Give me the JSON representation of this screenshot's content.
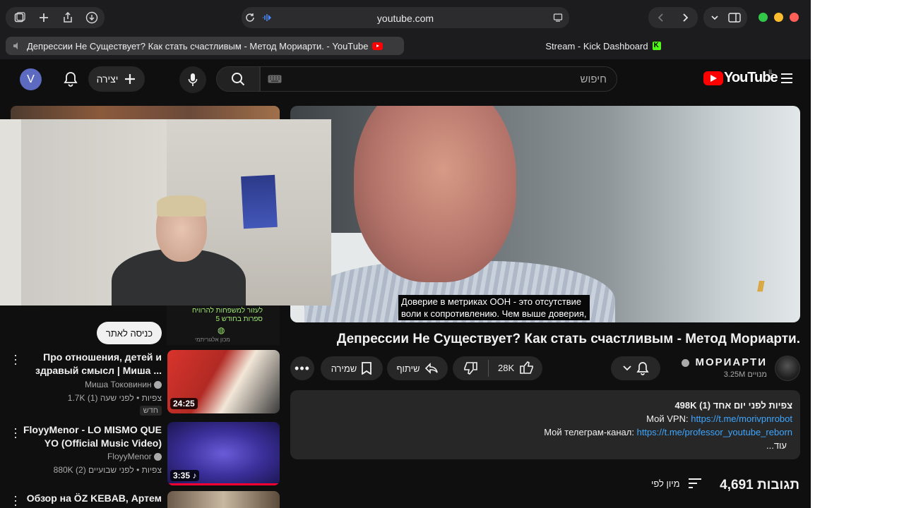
{
  "browser": {
    "url": "youtube.com",
    "tabs": [
      {
        "label": "Депрессии Не Существует? Как стать счастливым - Метод Мориарти. - YouTube",
        "active": true
      },
      {
        "label": "Stream - Kick Dashboard",
        "active": false
      }
    ],
    "traffic_lights": [
      "#32c748",
      "#febc2e",
      "#ff5f57"
    ]
  },
  "youtube": {
    "logo_text": "YouTube",
    "region": "IL",
    "search_placeholder": "חיפוש",
    "create_label": "יצירה",
    "avatar_letter": "V"
  },
  "player": {
    "subtitle_line1": "Доверие в метриках ООН - это отсутствие",
    "subtitle_line2": "воли к сопротивлению. Чем выше доверия,"
  },
  "video": {
    "title": "Депрессии Не Существует? Как стать счастливым - Метод Мориарти.",
    "channel_name": "МОРИАРТИ",
    "subscribers": "3.25M מנויים",
    "likes": "28K",
    "share_label": "שיתוף",
    "save_label": "שמירה"
  },
  "description": {
    "stats": "498K צפיות  לפני יום אחד (1)",
    "vpn_label": "Мой VPN:",
    "vpn_link": "https://t.me/morivpnrobot",
    "telegram_label": "Мой телеграм-канал:",
    "telegram_link": "https://t.me/professor_youtube_reborn",
    "more": "...עוד"
  },
  "comments": {
    "count_label": "4,691 תגובות",
    "sort_label": "מיון לפי"
  },
  "sidebar": {
    "ad_button": "כניסה לאתר",
    "ad_text_1": "לעזור למשפחות להרוויח",
    "ad_text_2": "5 ספרות בחודש",
    "ad_brand": "מכון אלגוריתמי",
    "recommendations": [
      {
        "title": "Про отношения, детей и здравый смысл | Миша ...",
        "channel": "Миша Токовинин",
        "meta": "1.7K צפיות • לפני שעה (1)",
        "badge": "חדש",
        "duration": "24:25"
      },
      {
        "title": "FloyyMenor - LO MISMO QUE YO (Official Music Video)",
        "channel": "FloyyMenor",
        "meta": "880K צפיות • לפני שבועיים (2)",
        "badge": "",
        "duration": "3:35"
      },
      {
        "title": "Обзор на ÖZ KEBAB, Артем",
        "channel": "",
        "meta": "",
        "badge": "",
        "duration": ""
      }
    ]
  },
  "colors": {
    "yt_red": "#ff0000",
    "kick_green": "#53fc18",
    "link_blue": "#3ea6ff"
  }
}
